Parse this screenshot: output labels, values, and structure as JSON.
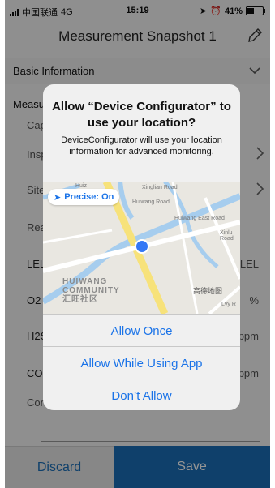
{
  "status_bar": {
    "carrier": "中国联通",
    "network": "4G",
    "time": "15:19",
    "battery": "41%"
  },
  "header": {
    "title": "Measurement Snapshot 1"
  },
  "basic_section": {
    "label": "Basic Information"
  },
  "measure_section": {
    "label": "Measu"
  },
  "rows": [
    {
      "label": "Cap",
      "right": ""
    },
    {
      "label": "Insp",
      "right": ""
    },
    {
      "label": "Site",
      "right": ""
    },
    {
      "label": "Rea",
      "right": ""
    },
    {
      "label": "LEL",
      "right": "LEL"
    },
    {
      "label": "O2",
      "right": "%"
    },
    {
      "label": "H2S",
      "right": "ppm"
    },
    {
      "label": "CO",
      "right": "ppm"
    },
    {
      "label": "Cor",
      "right": ""
    }
  ],
  "footer": {
    "discard": "Discard",
    "save": "Save"
  },
  "dialog": {
    "title": "Allow “Device Configurator” to use your location?",
    "message": "DeviceConfigurator will use your location information for advanced monitoring.",
    "precise": "Precise: On",
    "map_labels": {
      "road1": "Xinglian Road",
      "road2": "Huiwang East Road",
      "road3": "Huiwang Road",
      "road4": "Xinlu Road",
      "road5": "Huiz",
      "road6": "Lvy R",
      "community_en1": "HUIWANG",
      "community_en2": "COMMUNITY",
      "community_zh": "汇旺社区",
      "brand": "高德地图"
    },
    "options": [
      "Allow Once",
      "Allow While Using App",
      "Don’t Allow"
    ]
  },
  "colors": {
    "accent": "#1b6fb8",
    "ios_blue": "#1a73e8"
  }
}
